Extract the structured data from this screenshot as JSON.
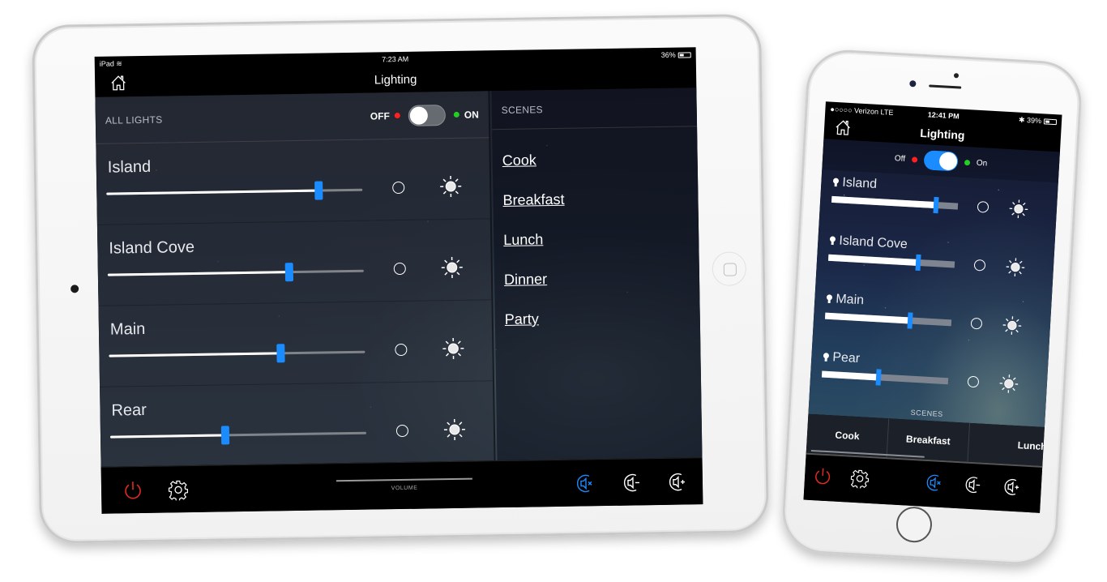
{
  "ipad": {
    "status": {
      "device": "iPad",
      "time": "7:23 AM",
      "battery": "36%"
    },
    "title": "Lighting",
    "all_lights": {
      "label": "ALL LIGHTS",
      "off_label": "OFF",
      "on_label": "ON",
      "state": "off"
    },
    "lights": [
      {
        "name": "Island",
        "level": 0.83
      },
      {
        "name": "Island Cove",
        "level": 0.71
      },
      {
        "name": "Main",
        "level": 0.67
      },
      {
        "name": "Rear",
        "level": 0.45
      }
    ],
    "scenes": {
      "label": "SCENES",
      "items": [
        "Cook",
        "Breakfast",
        "Lunch",
        "Dinner",
        "Party"
      ]
    },
    "bottom_bar": {
      "volume_label": "VOLUME"
    }
  },
  "iphone": {
    "status": {
      "carrier": "Verizon",
      "network": "LTE",
      "time": "12:41 PM",
      "battery": "39%"
    },
    "title": "Lighting",
    "all_lights": {
      "off_label": "Off",
      "on_label": "On",
      "state": "on"
    },
    "lights": [
      {
        "name": "Island",
        "level": 0.83
      },
      {
        "name": "Island Cove",
        "level": 0.71
      },
      {
        "name": "Main",
        "level": 0.67
      },
      {
        "name": "Pear",
        "level": 0.45
      }
    ],
    "scenes_label": "SCENES",
    "scenes": [
      "Cook",
      "Breakfast",
      "Lunch"
    ]
  },
  "colors": {
    "accent": "#1a8cff",
    "power": "#e02b20",
    "off_dot": "#ff2020",
    "on_dot": "#22d022"
  }
}
